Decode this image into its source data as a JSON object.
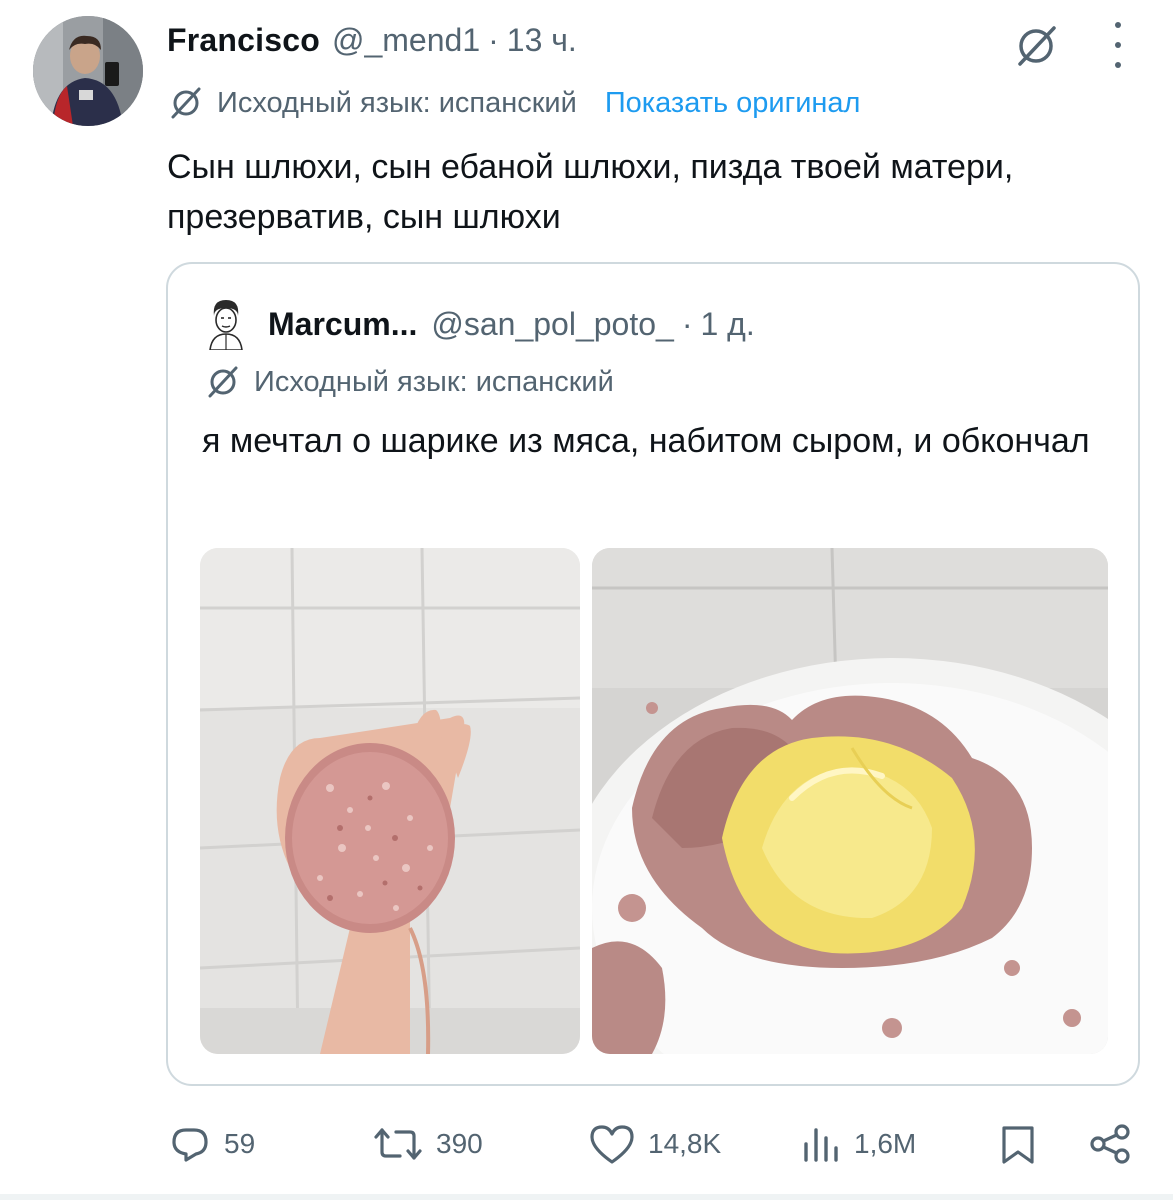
{
  "tweet": {
    "author_name": "Francisco",
    "author_handle": "@_mend1",
    "separator": "·",
    "time": "13 ч.",
    "language_label": "Исходный язык: испанский",
    "show_original": "Показать оригинал",
    "text": "Сын шлюхи, сын ебаной шлюхи, пизда твоей матери, презерватив, сын шлюхи"
  },
  "quote": {
    "author_name": "Marcum...",
    "author_handle": "@san_pol_poto_",
    "separator": "·",
    "time": "1 д.",
    "language_label": "Исходный язык: испанский",
    "text": "я мечтал о шарике из мяса, набитом сыром, и обкончал"
  },
  "actions": {
    "replies": "59",
    "retweets": "390",
    "likes": "14,8K",
    "views": "1,6M"
  },
  "colors": {
    "text_primary": "#0f1419",
    "text_secondary": "#536471",
    "link": "#1d9bf0",
    "border": "#cfd9de"
  },
  "icons": [
    "grok-icon",
    "more-icon",
    "translate-icon",
    "reply-icon",
    "retweet-icon",
    "like-icon",
    "views-icon",
    "bookmark-icon",
    "share-icon"
  ]
}
